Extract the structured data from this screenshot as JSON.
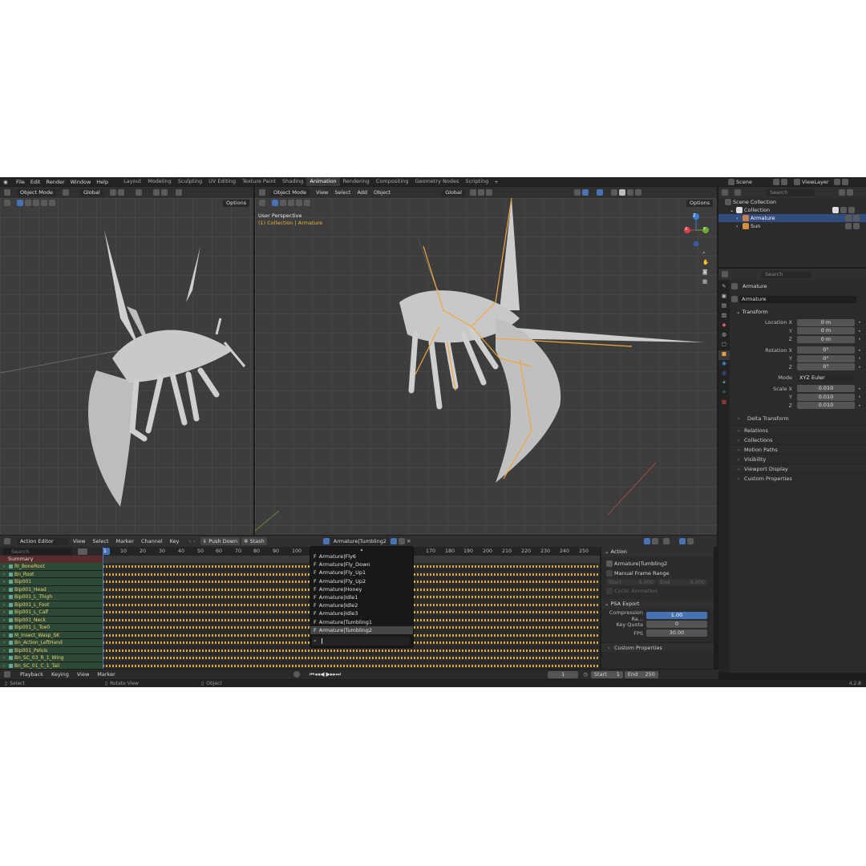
{
  "top_menu": [
    "File",
    "Edit",
    "Render",
    "Window",
    "Help"
  ],
  "workspaces": [
    "Layout",
    "Modeling",
    "Sculpting",
    "UV Editing",
    "Texture Paint",
    "Shading",
    "Animation",
    "Rendering",
    "Compositing",
    "Geometry Nodes",
    "Scripting"
  ],
  "active_workspace": "Animation",
  "add_workspace": "+",
  "scene": {
    "name": "Scene",
    "view_layer": "ViewLayer"
  },
  "left_viewport": {
    "mode": "Object Mode",
    "orientation": "Global",
    "options": "Options"
  },
  "main_viewport": {
    "mode": "Object Mode",
    "menus": [
      "View",
      "Select",
      "Add",
      "Object"
    ],
    "orientation": "Global",
    "options": "Options",
    "title": "User Perspective",
    "subtitle": "(1) Collection | Armature",
    "gizmo": {
      "x": "X",
      "y": "Y",
      "z": "Z"
    }
  },
  "outliner": {
    "search_placeholder": "Search",
    "scene_collection": "Scene Collection",
    "collection": "Collection",
    "items": [
      {
        "name": "Armature",
        "selected": true
      },
      {
        "name": "Sun",
        "selected": false
      }
    ]
  },
  "properties": {
    "search_placeholder": "Search",
    "object_name": "Armature",
    "object_field": "Armature",
    "transform_title": "Transform",
    "location": [
      {
        "label": "Location X",
        "value": "0 m"
      },
      {
        "label": "Y",
        "value": "0 m"
      },
      {
        "label": "Z",
        "value": "0 m"
      }
    ],
    "rotation": [
      {
        "label": "Rotation X",
        "value": "0°"
      },
      {
        "label": "Y",
        "value": "0°"
      },
      {
        "label": "Z",
        "value": "0°"
      }
    ],
    "mode_label": "Mode",
    "mode_value": "XYZ Euler",
    "scale": [
      {
        "label": "Scale X",
        "value": "0.010"
      },
      {
        "label": "Y",
        "value": "0.010"
      },
      {
        "label": "Z",
        "value": "0.010"
      }
    ],
    "delta_transform": "Delta Transform",
    "sections": [
      "Relations",
      "Collections",
      "Motion Paths",
      "Visibility",
      "Viewport Display",
      "Custom Properties"
    ]
  },
  "action_editor": {
    "editor_type": "Action Editor",
    "menus": [
      "View",
      "Select",
      "Marker",
      "Channel",
      "Key"
    ],
    "push_down": "Push Down",
    "stash": "Stash",
    "action_name": "Armature|Tumbling2",
    "search_placeholder": "Search",
    "current_frame_marker": "1",
    "frame_ticks": [
      "10",
      "20",
      "30",
      "40",
      "50",
      "60",
      "70",
      "80",
      "90",
      "100",
      "170",
      "180",
      "190",
      "200",
      "210",
      "220",
      "230",
      "240",
      "250"
    ],
    "summary": "Summary",
    "channels": [
      "RI_BoneRoot",
      "Bn_Root",
      "Bip001",
      "Bip001_Head",
      "Bip001_L_Thigh",
      "Bip001_L_Foot",
      "Bip001_L_Calf",
      "Bip001_Neck",
      "Bip001_L_Toe0",
      "M_Insect_Wasp_SK",
      "Bn_Action_LeftHand",
      "Bip001_Pelvis",
      "Bn_SC_03_R_1_Wing",
      "Bn_SC_01_C_1_Tail"
    ]
  },
  "action_dropdown": {
    "items": [
      "Armature|Fly6",
      "Armature|Fly_Down",
      "Armature|Fly_Up1",
      "Armature|Fly_Up2",
      "Armature|Honey",
      "Armature|Idle1",
      "Armature|Idle2",
      "Armature|Idle3",
      "Armature|Tumbling1",
      "Armature|Tumbling2"
    ],
    "prefix": "F",
    "selected_index": 9
  },
  "side_panel": {
    "action_title": "Action",
    "action_name": "Armature|Tumbling2",
    "manual_frame_range": "Manual Frame Range",
    "start_label": "Start",
    "start_value": "0.000",
    "end_label": "End",
    "end_value": "0.000",
    "cyclic": "Cyclic Animation",
    "psa_title": "PSA Export",
    "compression_label": "Compression Ra...",
    "compression_value": "1.00",
    "key_quota_label": "Key Quota",
    "key_quota_value": "0",
    "fps_label": "FPS",
    "fps_value": "30.00",
    "custom_props": "Custom Properties"
  },
  "playback_bar": {
    "menus": [
      "Playback",
      "Keying",
      "View",
      "Marker"
    ],
    "current_frame": "1",
    "start_label": "Start",
    "start_value": "1",
    "end_label": "End",
    "end_value": "250"
  },
  "status_bar": {
    "select": "Select",
    "rotate": "Rotate View",
    "object": "Object",
    "version": "4.2.8"
  }
}
